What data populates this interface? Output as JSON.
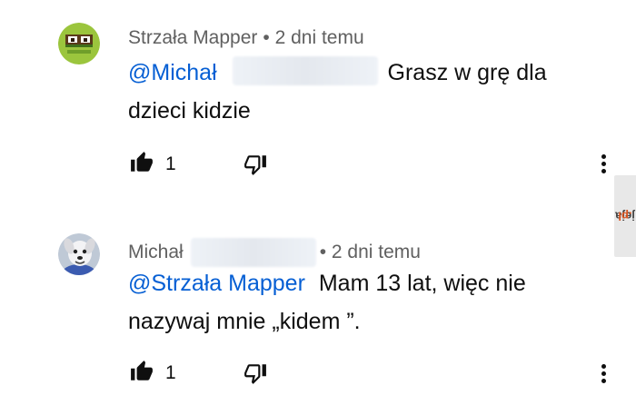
{
  "comments": [
    {
      "author": "Strzała Mapper",
      "time": "• 2 dni temu",
      "mention": "@Michał",
      "text": "Grasz w grę dla",
      "text_line2": "dzieci kidzie",
      "likes": "1",
      "avatar_icon": "green-pixel-face-avatar"
    },
    {
      "author": "Michał",
      "time": "• 2 dni temu",
      "mention": "@Strzała Mapper",
      "text": "Mam 13 lat, więc nie",
      "text_line2": "nazywaj mnie „kidem ”.",
      "likes": "1",
      "avatar_icon": "cartoon-dog-avatar"
    }
  ],
  "icons": {
    "like": "thumbs-up-filled-icon",
    "dislike": "thumbs-down-outline-icon",
    "menu": "more-vertical-icon"
  },
  "watermark": {
    "main": "jeja",
    "suffix": ".pl"
  },
  "colors": {
    "mention": "#065fd4",
    "meta": "#606060",
    "text": "#0f0f0f"
  }
}
